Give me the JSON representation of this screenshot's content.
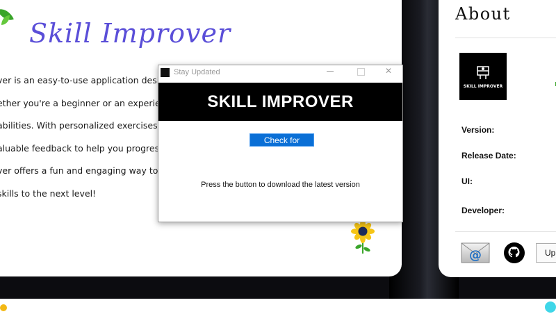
{
  "main": {
    "app_title": "Skill Improver",
    "description_lines": [
      "ver is an easy-to-use application designed",
      "ether you're a beginner or an experienced",
      " abilities. With personalized exercises and",
      "aluable feedback to help you progress.Dev",
      "ver offers a fun and engaging way to pract",
      " skills to the next level!"
    ]
  },
  "about": {
    "title": "About",
    "logo_text": "SKILL IMPROVER",
    "labels": {
      "version": "Version:",
      "release_date": "Release Date:",
      "ui": "UI:",
      "developer": "Developer:"
    },
    "update_button": "Up",
    "icons": [
      "email-icon",
      "github-icon"
    ]
  },
  "dialog": {
    "window_title": "Stay Updated",
    "banner_text": "SKILL IMPROVER",
    "check_button": "Check for Update",
    "hint_text": "Press the button to download the latest version",
    "close_glyph": "✕"
  },
  "colors": {
    "title_purple": "#5a4ed8",
    "button_blue": "#0a6fd6",
    "banner_black": "#000000"
  }
}
